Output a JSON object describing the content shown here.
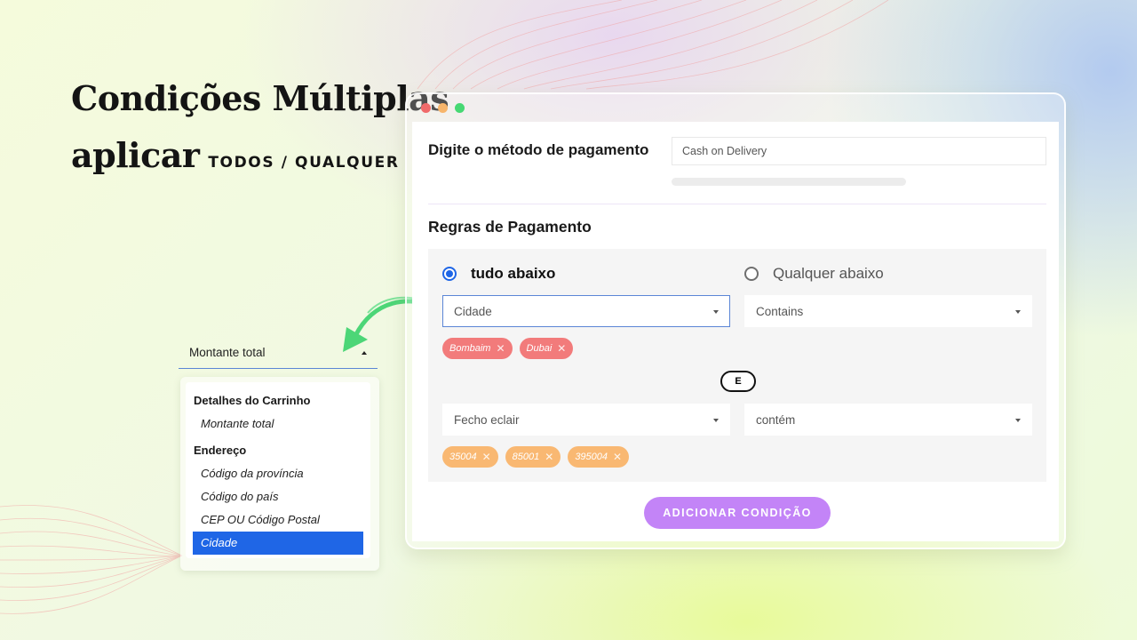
{
  "hero": {
    "title": "Condições Múltiplas",
    "subtitle_word": "aplicar",
    "subtitle_caps": "TODOS / QUALQUER"
  },
  "window": {
    "controls": [
      {
        "name": "close",
        "color": "#f06a6a"
      },
      {
        "name": "minimize",
        "color": "#f7b56b"
      },
      {
        "name": "maximize",
        "color": "#46d873"
      }
    ],
    "payment_method_label": "Digite o método de pagamento",
    "payment_method_value": "Cash on Delivery",
    "rules_title": "Regras de Pagamento",
    "match_options": {
      "all_label": "tudo abaixo",
      "any_label": "Qualquer abaixo",
      "selected": "all"
    },
    "conditions": [
      {
        "field": "Cidade",
        "operator": "Contains",
        "values": [
          "Bombaim",
          "Dubai"
        ],
        "chip_color": "#f27b7b"
      },
      {
        "field": "Fecho eclair",
        "operator": "contém",
        "values": [
          "35004",
          "85001",
          "395004"
        ],
        "chip_color": "#f9b872"
      }
    ],
    "connector_label": "E",
    "add_condition_label": "ADICIONAR CONDIÇÃO",
    "accent_color": "#c384f7"
  },
  "dropdown": {
    "field_value": "Montante total",
    "groups": [
      {
        "label": "Detalhes do Carrinho",
        "items": [
          "Montante total"
        ]
      },
      {
        "label": "Endereço",
        "items": [
          "Código da província",
          "Código do país",
          "CEP OU Código Postal",
          "Cidade"
        ]
      }
    ],
    "selected_item": "Cidade",
    "selected_color": "#1f66e6"
  }
}
